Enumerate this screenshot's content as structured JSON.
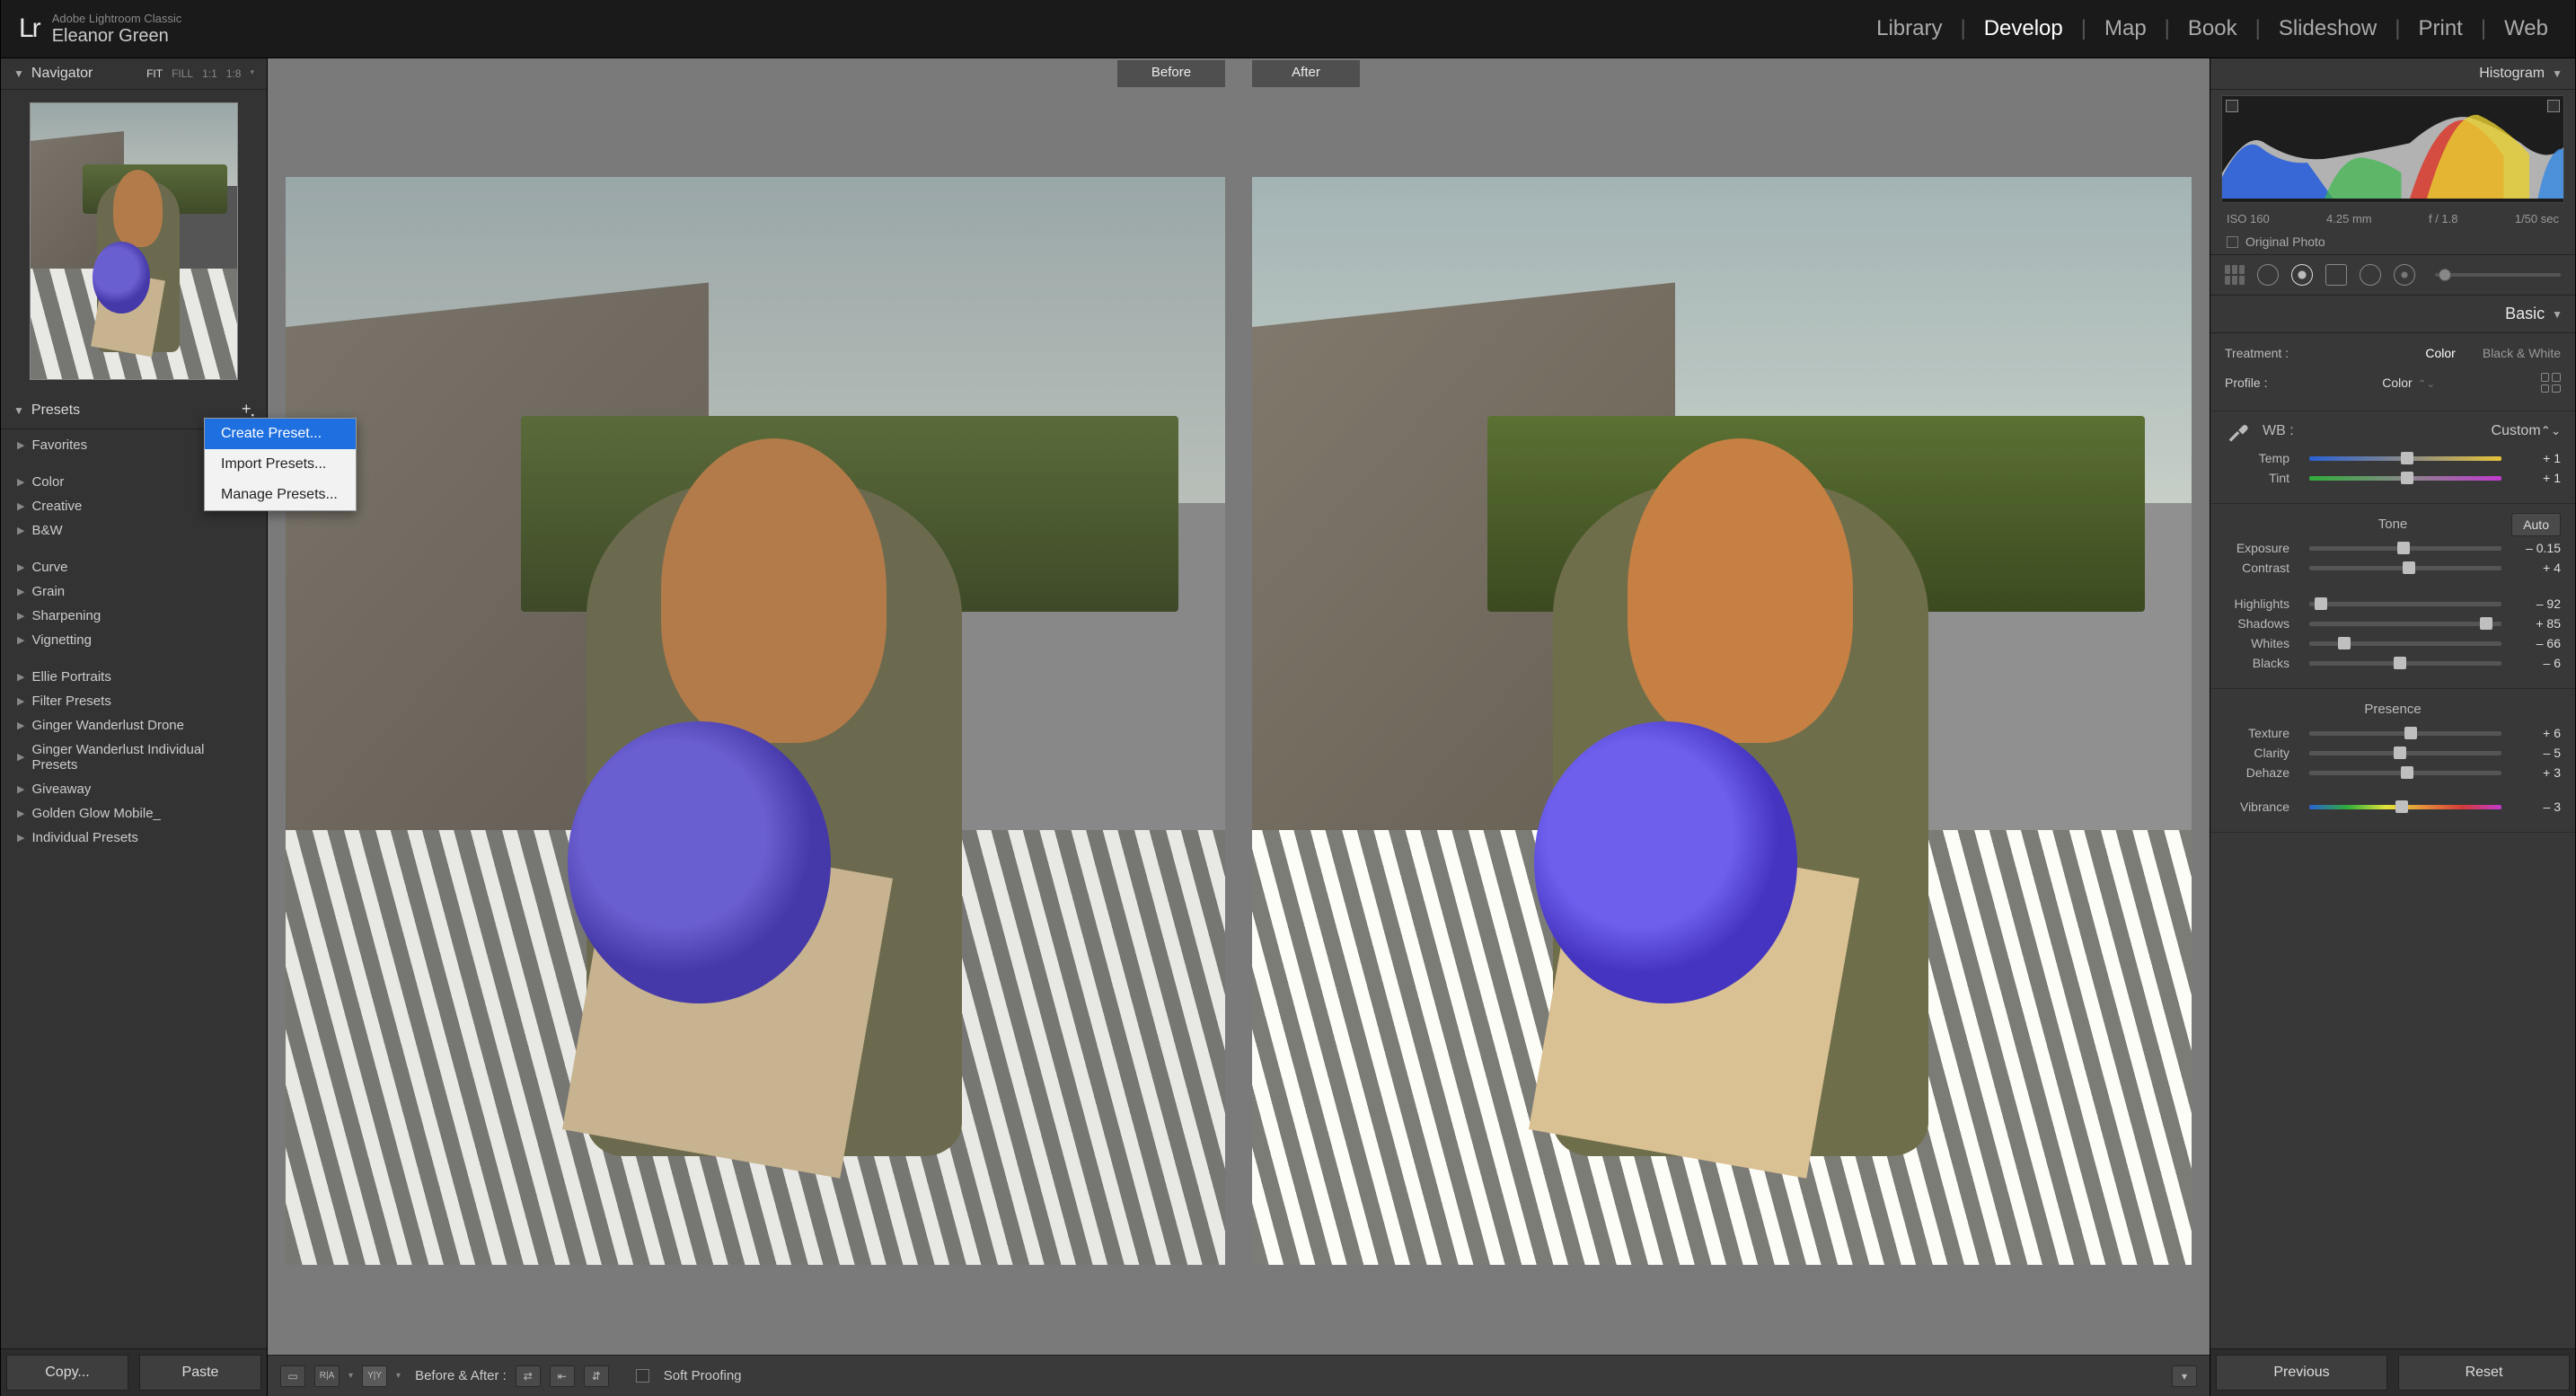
{
  "app": {
    "name": "Adobe Lightroom Classic",
    "user": "Eleanor Green",
    "logo": "Lr"
  },
  "modules": {
    "items": [
      "Library",
      "Develop",
      "Map",
      "Book",
      "Slideshow",
      "Print",
      "Web"
    ],
    "active": "Develop"
  },
  "navigator": {
    "title": "Navigator",
    "fit": "FIT",
    "fill": "FILL",
    "oneone": "1:1",
    "ratio": "1:8"
  },
  "presets": {
    "title": "Presets",
    "items": [
      "Favorites"
    ],
    "items2": [
      "Color",
      "Creative",
      "B&W"
    ],
    "items3": [
      "Curve",
      "Grain",
      "Sharpening",
      "Vignetting"
    ],
    "items4": [
      "Ellie Portraits",
      "Filter Presets",
      "Ginger Wanderlust Drone",
      "Ginger Wanderlust Individual Presets",
      "Giveaway",
      "Golden Glow Mobile_",
      "Individual Presets"
    ]
  },
  "leftFoot": {
    "copy": "Copy...",
    "paste": "Paste"
  },
  "ctx": {
    "create": "Create Preset...",
    "import": "Import Presets...",
    "manage": "Manage Presets..."
  },
  "ba": {
    "before": "Before",
    "after": "After",
    "label": "Before & After :",
    "soft": "Soft Proofing"
  },
  "histogram": {
    "title": "Histogram",
    "iso": "ISO 160",
    "focal": "4.25 mm",
    "fstop": "f / 1.8",
    "shutter": "1/50 sec",
    "orig": "Original Photo"
  },
  "basic": {
    "title": "Basic",
    "treatment": {
      "label": "Treatment :",
      "color": "Color",
      "bw": "Black & White"
    },
    "profile": {
      "label": "Profile :",
      "value": "Color"
    },
    "wb": {
      "label": "WB :",
      "value": "Custom"
    },
    "temp": {
      "label": "Temp",
      "value": "+ 1",
      "pos": 51
    },
    "tint": {
      "label": "Tint",
      "value": "+ 1",
      "pos": 51
    },
    "tone": {
      "title": "Tone",
      "auto": "Auto"
    },
    "exposure": {
      "label": "Exposure",
      "value": "– 0.15",
      "pos": 49
    },
    "contrast": {
      "label": "Contrast",
      "value": "+ 4",
      "pos": 52
    },
    "highlights": {
      "label": "Highlights",
      "value": "– 92",
      "pos": 6
    },
    "shadows": {
      "label": "Shadows",
      "value": "+ 85",
      "pos": 92
    },
    "whites": {
      "label": "Whites",
      "value": "– 66",
      "pos": 18
    },
    "blacks": {
      "label": "Blacks",
      "value": "– 6",
      "pos": 47
    },
    "presence": {
      "title": "Presence"
    },
    "texture": {
      "label": "Texture",
      "value": "+ 6",
      "pos": 53
    },
    "clarity": {
      "label": "Clarity",
      "value": "– 5",
      "pos": 47
    },
    "dehaze": {
      "label": "Dehaze",
      "value": "+ 3",
      "pos": 51
    },
    "vibrance": {
      "label": "Vibrance",
      "value": "– 3",
      "pos": 48
    }
  },
  "rightFoot": {
    "prev": "Previous",
    "reset": "Reset"
  }
}
